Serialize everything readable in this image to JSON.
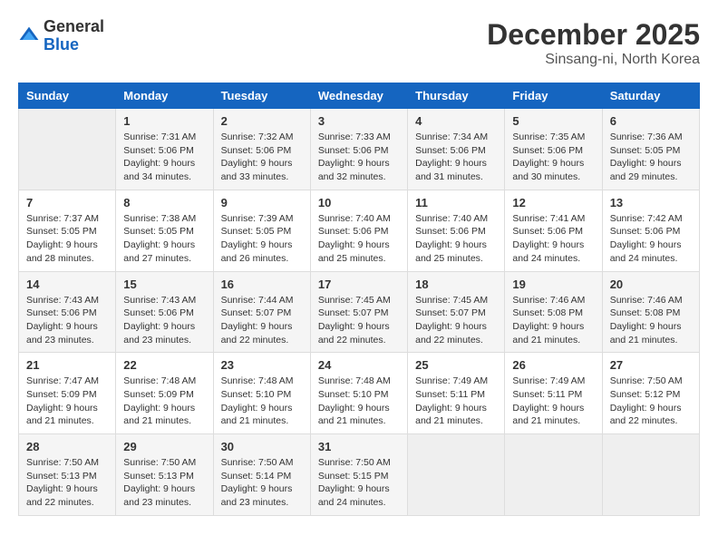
{
  "header": {
    "logo_general": "General",
    "logo_blue": "Blue",
    "month": "December 2025",
    "location": "Sinsang-ni, North Korea"
  },
  "weekdays": [
    "Sunday",
    "Monday",
    "Tuesday",
    "Wednesday",
    "Thursday",
    "Friday",
    "Saturday"
  ],
  "weeks": [
    [
      {
        "day": "",
        "info": ""
      },
      {
        "day": "1",
        "info": "Sunrise: 7:31 AM\nSunset: 5:06 PM\nDaylight: 9 hours\nand 34 minutes."
      },
      {
        "day": "2",
        "info": "Sunrise: 7:32 AM\nSunset: 5:06 PM\nDaylight: 9 hours\nand 33 minutes."
      },
      {
        "day": "3",
        "info": "Sunrise: 7:33 AM\nSunset: 5:06 PM\nDaylight: 9 hours\nand 32 minutes."
      },
      {
        "day": "4",
        "info": "Sunrise: 7:34 AM\nSunset: 5:06 PM\nDaylight: 9 hours\nand 31 minutes."
      },
      {
        "day": "5",
        "info": "Sunrise: 7:35 AM\nSunset: 5:06 PM\nDaylight: 9 hours\nand 30 minutes."
      },
      {
        "day": "6",
        "info": "Sunrise: 7:36 AM\nSunset: 5:05 PM\nDaylight: 9 hours\nand 29 minutes."
      }
    ],
    [
      {
        "day": "7",
        "info": "Sunrise: 7:37 AM\nSunset: 5:05 PM\nDaylight: 9 hours\nand 28 minutes."
      },
      {
        "day": "8",
        "info": "Sunrise: 7:38 AM\nSunset: 5:05 PM\nDaylight: 9 hours\nand 27 minutes."
      },
      {
        "day": "9",
        "info": "Sunrise: 7:39 AM\nSunset: 5:05 PM\nDaylight: 9 hours\nand 26 minutes."
      },
      {
        "day": "10",
        "info": "Sunrise: 7:40 AM\nSunset: 5:06 PM\nDaylight: 9 hours\nand 25 minutes."
      },
      {
        "day": "11",
        "info": "Sunrise: 7:40 AM\nSunset: 5:06 PM\nDaylight: 9 hours\nand 25 minutes."
      },
      {
        "day": "12",
        "info": "Sunrise: 7:41 AM\nSunset: 5:06 PM\nDaylight: 9 hours\nand 24 minutes."
      },
      {
        "day": "13",
        "info": "Sunrise: 7:42 AM\nSunset: 5:06 PM\nDaylight: 9 hours\nand 24 minutes."
      }
    ],
    [
      {
        "day": "14",
        "info": "Sunrise: 7:43 AM\nSunset: 5:06 PM\nDaylight: 9 hours\nand 23 minutes."
      },
      {
        "day": "15",
        "info": "Sunrise: 7:43 AM\nSunset: 5:06 PM\nDaylight: 9 hours\nand 23 minutes."
      },
      {
        "day": "16",
        "info": "Sunrise: 7:44 AM\nSunset: 5:07 PM\nDaylight: 9 hours\nand 22 minutes."
      },
      {
        "day": "17",
        "info": "Sunrise: 7:45 AM\nSunset: 5:07 PM\nDaylight: 9 hours\nand 22 minutes."
      },
      {
        "day": "18",
        "info": "Sunrise: 7:45 AM\nSunset: 5:07 PM\nDaylight: 9 hours\nand 22 minutes."
      },
      {
        "day": "19",
        "info": "Sunrise: 7:46 AM\nSunset: 5:08 PM\nDaylight: 9 hours\nand 21 minutes."
      },
      {
        "day": "20",
        "info": "Sunrise: 7:46 AM\nSunset: 5:08 PM\nDaylight: 9 hours\nand 21 minutes."
      }
    ],
    [
      {
        "day": "21",
        "info": "Sunrise: 7:47 AM\nSunset: 5:09 PM\nDaylight: 9 hours\nand 21 minutes."
      },
      {
        "day": "22",
        "info": "Sunrise: 7:48 AM\nSunset: 5:09 PM\nDaylight: 9 hours\nand 21 minutes."
      },
      {
        "day": "23",
        "info": "Sunrise: 7:48 AM\nSunset: 5:10 PM\nDaylight: 9 hours\nand 21 minutes."
      },
      {
        "day": "24",
        "info": "Sunrise: 7:48 AM\nSunset: 5:10 PM\nDaylight: 9 hours\nand 21 minutes."
      },
      {
        "day": "25",
        "info": "Sunrise: 7:49 AM\nSunset: 5:11 PM\nDaylight: 9 hours\nand 21 minutes."
      },
      {
        "day": "26",
        "info": "Sunrise: 7:49 AM\nSunset: 5:11 PM\nDaylight: 9 hours\nand 21 minutes."
      },
      {
        "day": "27",
        "info": "Sunrise: 7:50 AM\nSunset: 5:12 PM\nDaylight: 9 hours\nand 22 minutes."
      }
    ],
    [
      {
        "day": "28",
        "info": "Sunrise: 7:50 AM\nSunset: 5:13 PM\nDaylight: 9 hours\nand 22 minutes."
      },
      {
        "day": "29",
        "info": "Sunrise: 7:50 AM\nSunset: 5:13 PM\nDaylight: 9 hours\nand 23 minutes."
      },
      {
        "day": "30",
        "info": "Sunrise: 7:50 AM\nSunset: 5:14 PM\nDaylight: 9 hours\nand 23 minutes."
      },
      {
        "day": "31",
        "info": "Sunrise: 7:50 AM\nSunset: 5:15 PM\nDaylight: 9 hours\nand 24 minutes."
      },
      {
        "day": "",
        "info": ""
      },
      {
        "day": "",
        "info": ""
      },
      {
        "day": "",
        "info": ""
      }
    ]
  ]
}
